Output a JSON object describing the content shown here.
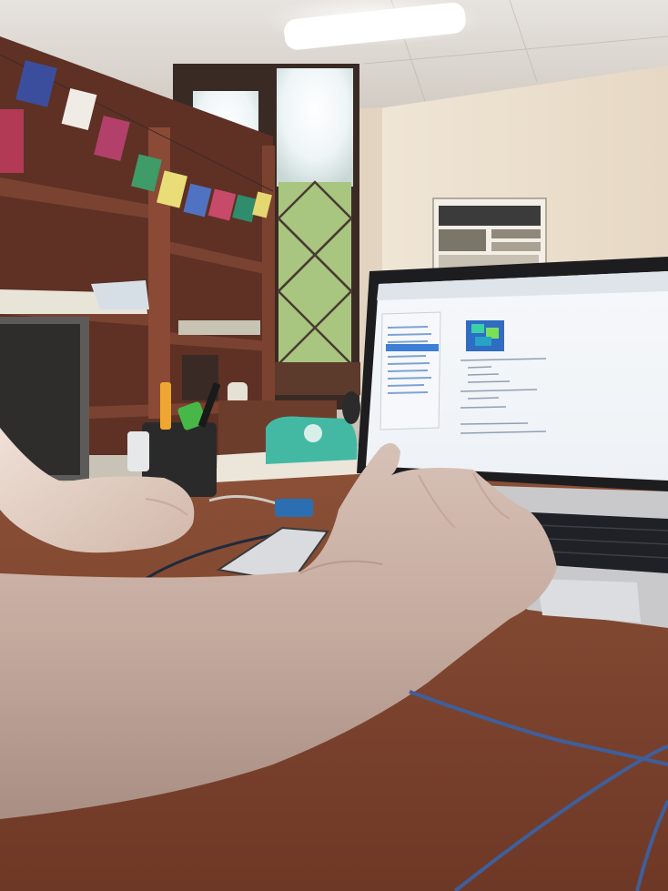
{
  "scene": {
    "type": "photo",
    "colors": {
      "ceiling": "#d9d3cb",
      "wall": "#e8dccb",
      "shelf_wood": "#6b3a2c",
      "desk_wood": "#8a4a32",
      "window_light": "#f4f7fb",
      "laptop_screen": "#f2f5fa",
      "skin": "#d9b8a3",
      "cable": "#3f5f9a"
    }
  },
  "poster": {
    "text": ""
  },
  "laptop_screen": {
    "editor_code_visible": true
  }
}
